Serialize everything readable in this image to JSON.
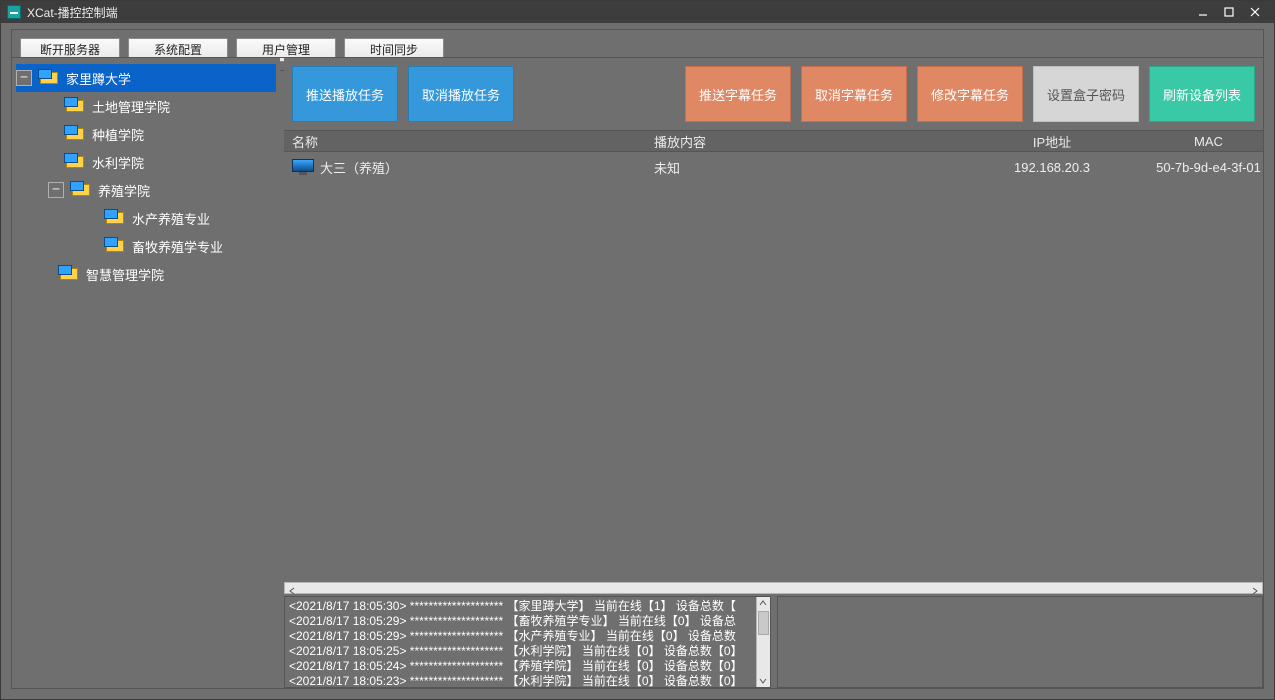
{
  "window": {
    "title": "XCat-播控控制端"
  },
  "toolbar": {
    "disconnect": "断开服务器",
    "sysconfig": "系统配置",
    "usermgmt": "用户管理",
    "timesync": "时间同步"
  },
  "tree": {
    "items": [
      {
        "label": "家里蹲大学",
        "level": 0,
        "toggle": "−",
        "selected": true
      },
      {
        "label": "土地管理学院",
        "level": 1
      },
      {
        "label": "种植学院",
        "level": 1
      },
      {
        "label": "水利学院",
        "level": 1
      },
      {
        "label": "养殖学院",
        "level": 1,
        "toggle": "−",
        "hasToggle": true,
        "toggleAt": 2
      },
      {
        "label": "水产养殖专业",
        "level": 3
      },
      {
        "label": "畜牧养殖学专业",
        "level": 3
      },
      {
        "label": "智慧管理学院",
        "level": 1
      }
    ]
  },
  "actions": {
    "push_play": "推送播放任务",
    "cancel_play": "取消播放任务",
    "push_sub": "推送字幕任务",
    "cancel_sub": "取消字幕任务",
    "modify_sub": "修改字幕任务",
    "set_box_pwd": "设置盒子密码",
    "refresh": "刷新设备列表"
  },
  "grid": {
    "headers": {
      "name": "名称",
      "play": "播放内容",
      "ip": "IP地址",
      "mac": "MAC"
    },
    "rows": [
      {
        "name": "大三（养殖）",
        "play": "未知",
        "ip": "192.168.20.3",
        "mac": "50-7b-9d-e4-3f-01"
      }
    ]
  },
  "log": {
    "lines": [
      "<2021/8/17 18:05:30> ******************** 【家里蹲大学】 当前在线【1】 设备总数【",
      "<2021/8/17 18:05:29> ******************** 【畜牧养殖学专业】 当前在线【0】 设备总",
      "<2021/8/17 18:05:29> ******************** 【水产养殖专业】 当前在线【0】 设备总数",
      "<2021/8/17 18:05:25> ******************** 【水利学院】 当前在线【0】 设备总数【0】",
      "<2021/8/17 18:05:24> ******************** 【养殖学院】 当前在线【0】 设备总数【0】",
      "<2021/8/17 18:05:23> ******************** 【水利学院】 当前在线【0】 设备总数【0】"
    ]
  }
}
